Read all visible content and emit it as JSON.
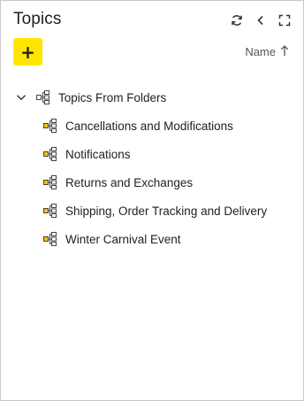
{
  "header": {
    "title": "Topics",
    "icons": [
      "refresh-icon",
      "collapse-left-icon",
      "expand-icon"
    ]
  },
  "toolbar": {
    "add_label": "+",
    "sort_label": "Name",
    "sort_direction": "ascending"
  },
  "tree": {
    "root": {
      "label": "Topics From Folders",
      "expanded": true,
      "icon": "topic-tree-icon"
    },
    "children": [
      {
        "label": "Cancellations and Modifications",
        "icon": "topic-tree-icon"
      },
      {
        "label": "Notifications",
        "icon": "topic-tree-icon"
      },
      {
        "label": "Returns and Exchanges",
        "icon": "topic-tree-icon"
      },
      {
        "label": "Shipping, Order Tracking and Delivery",
        "icon": "topic-tree-icon"
      },
      {
        "label": "Winter Carnival Event",
        "icon": "topic-tree-icon"
      }
    ]
  },
  "colors": {
    "accent": "#ffe600",
    "icon_yellow": "#f2c400",
    "icon_dark": "#444444"
  }
}
